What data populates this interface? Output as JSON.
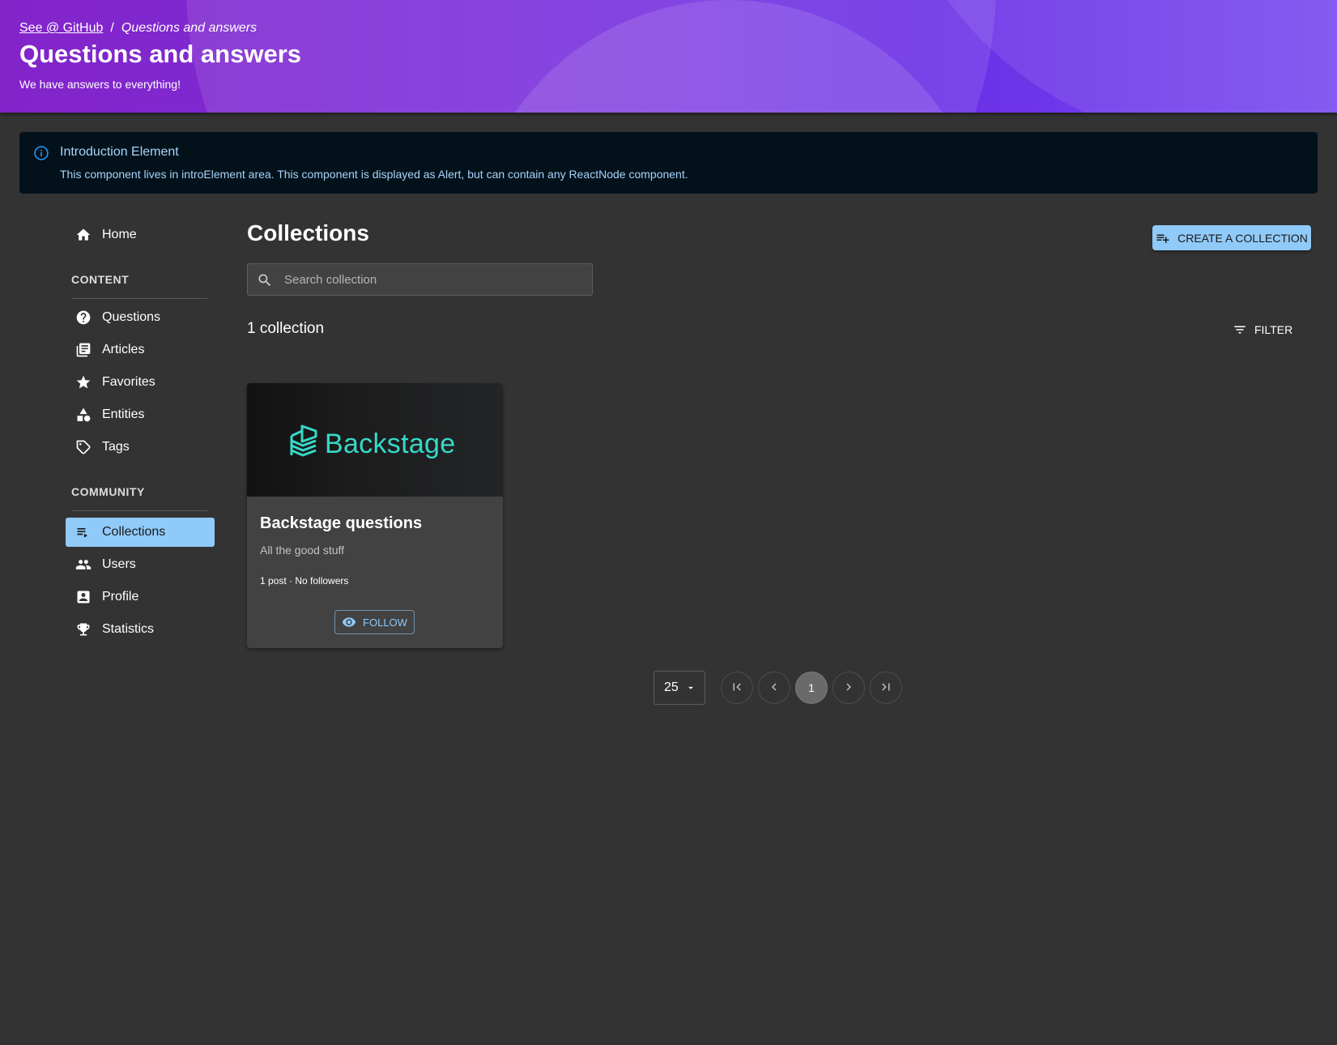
{
  "header": {
    "breadcrumb_link": "See @ GitHub",
    "breadcrumb_separator": "/",
    "breadcrumb_current": "Questions and answers",
    "title": "Questions and answers",
    "subtitle": "We have answers to everything!"
  },
  "intro": {
    "icon": "info-icon",
    "title": "Introduction Element",
    "body": "This component lives in introElement area. This component is displayed as Alert, but can contain any ReactNode component."
  },
  "sidebar": {
    "home": {
      "label": "Home",
      "icon": "home-icon"
    },
    "content_heading": "CONTENT",
    "content_items": [
      {
        "label": "Questions",
        "icon": "help-circle-icon"
      },
      {
        "label": "Articles",
        "icon": "library-books-icon"
      },
      {
        "label": "Favorites",
        "icon": "star-icon"
      },
      {
        "label": "Entities",
        "icon": "category-shapes-icon"
      },
      {
        "label": "Tags",
        "icon": "tag-icon"
      }
    ],
    "community_heading": "COMMUNITY",
    "community_items": [
      {
        "label": "Collections",
        "icon": "playlist-icon",
        "active": true
      },
      {
        "label": "Users",
        "icon": "people-icon"
      },
      {
        "label": "Profile",
        "icon": "account-box-icon"
      },
      {
        "label": "Statistics",
        "icon": "trophy-icon"
      }
    ]
  },
  "main": {
    "title": "Collections",
    "create_button": "CREATE A COLLECTION",
    "search_placeholder": "Search collection",
    "count_label": "1 collection",
    "filter_button": "FILTER"
  },
  "collections": [
    {
      "logo_text": "Backstage",
      "title": "Backstage questions",
      "description": "All the good stuff",
      "stats": "1 post · No followers",
      "follow_label": "FOLLOW"
    }
  ],
  "pagination": {
    "page_size": "25",
    "current_page": "1"
  },
  "colors": {
    "accent": "#90caf9",
    "background": "#333333",
    "card": "#424242",
    "header_gradient_start": "#8324c9",
    "header_gradient_end": "#7a4bf0",
    "logo_teal": "#36d9c8"
  }
}
